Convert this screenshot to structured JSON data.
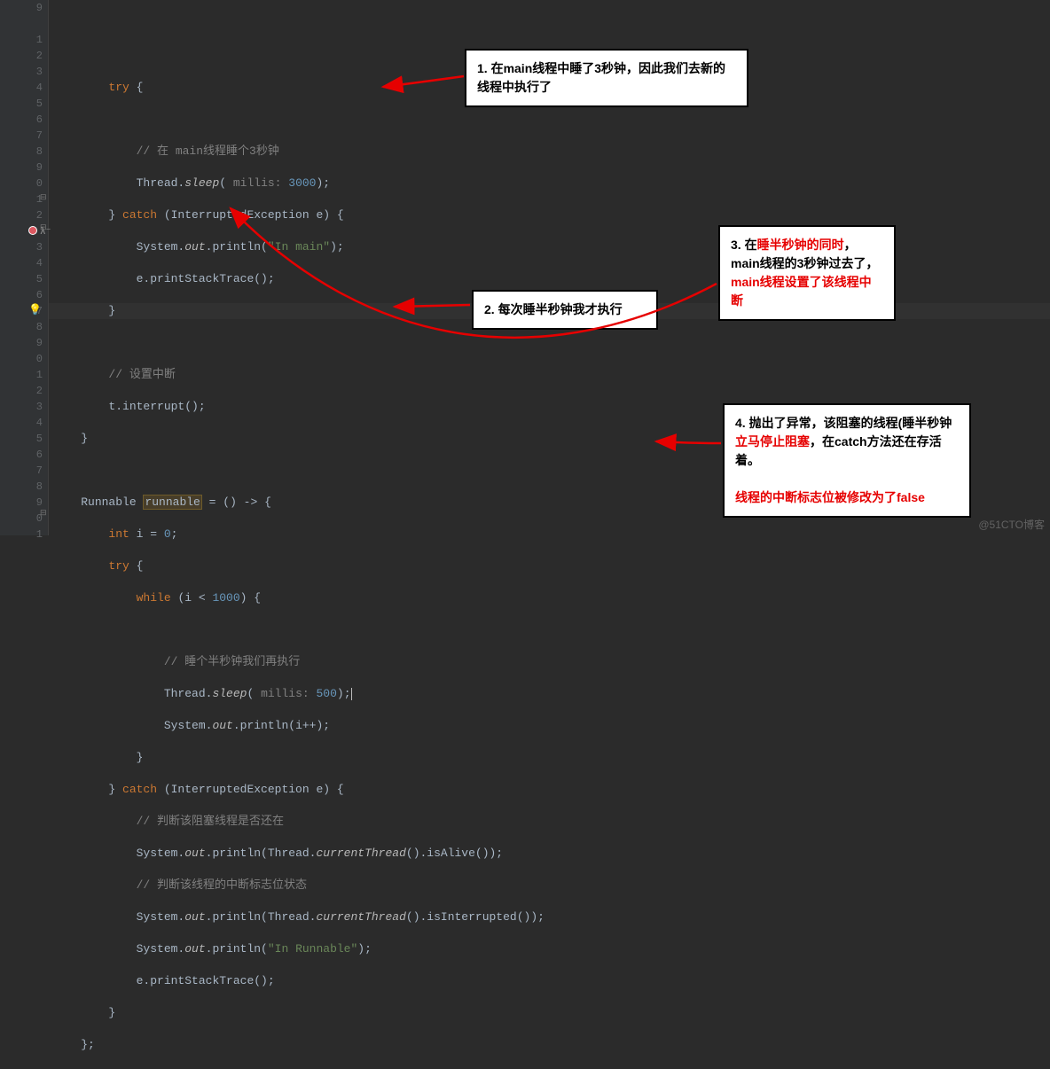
{
  "line_numbers": [
    "9",
    "",
    "1",
    "2",
    "3",
    "4",
    "5",
    "6",
    "7",
    "8",
    "9",
    "0",
    "1",
    "2",
    "",
    "3",
    "4",
    "5",
    "6",
    "7",
    "8",
    "9",
    "0",
    "1",
    "2",
    "3",
    "4",
    "5",
    "6",
    "7",
    "8",
    "9",
    "0",
    "1",
    ""
  ],
  "code": {
    "try": "try",
    "catch": "catch",
    "int_kw": "int",
    "while": "while",
    "cmt_sleep3": "// 在 main线程睡个3秒钟",
    "thread": "Thread.",
    "sleep": "sleep",
    "millis": " millis: ",
    "n3000": "3000",
    "catch_sig": " (InterruptedException e) {",
    "system": "System.",
    "out": "out",
    "println": ".println(",
    "in_main": "\"In main\"",
    "eprint": "e.printStackTrace();",
    "cmt_set_int": "// 设置中断",
    "t_interrupt": "t.interrupt();",
    "runnable_decl": "Runnable ",
    "runnable_var": "runnable",
    "lambda_eq": " = () -> {",
    "int_i": " i = ",
    "zero": "0",
    "while_cond": " (i < ",
    "n1000": "1000",
    "cmt_half": "// 睡个半秒钟我们再执行",
    "n500": "500",
    "ipp": "i++);",
    "cmt_alive": "// 判断该阻塞线程是否还在",
    "currentThread": "currentThread",
    "isAlive": "().isAlive());",
    "cmt_flag": "// 判断该线程的中断标志位状态",
    "isInterrupted": "().isInterrupted());",
    "in_runnable": "\"In Runnable\"",
    "end_brace": "}",
    "end_stmt": "};"
  },
  "annotations": {
    "box1": "1. 在main线程中睡了3秒钟，因此我们去新的线程中执行了",
    "box2": "2. 每次睡半秒钟我才执行",
    "box3_a": "3. 在",
    "box3_b": "睡半秒钟的同时",
    "box3_c": "，main线程的3秒钟过去了，",
    "box3_d": "main线程设置了该线程中断",
    "box4_a": "4. 抛出了异常，该阻塞的线程(睡半秒钟",
    "box4_b": "立马停止阻塞",
    "box4_c": "，在catch方法还在存活着。",
    "box4_d": "线程的中断标志位被修改为了false"
  },
  "watermark": "@51CTO博客"
}
